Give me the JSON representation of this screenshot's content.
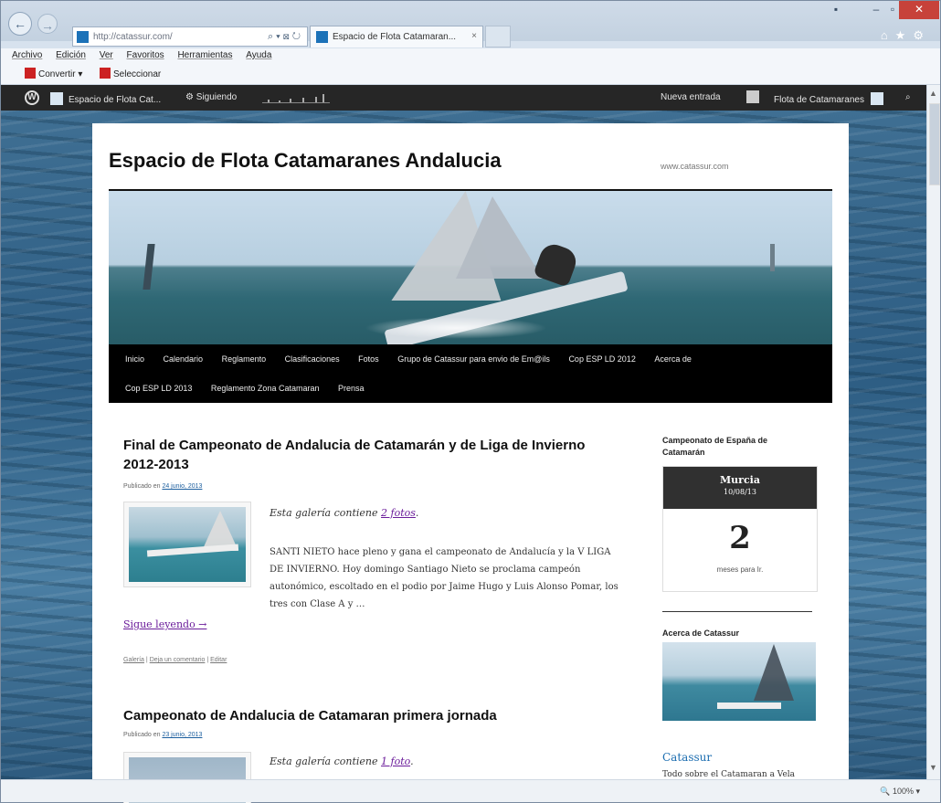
{
  "browser": {
    "url": "http://catassur.com/",
    "tab_title": "Espacio de Flota Catamaran...",
    "menu": [
      "Archivo",
      "Edición",
      "Ver",
      "Favoritos",
      "Herramientas",
      "Ayuda"
    ],
    "cmd_convert": "Convertir",
    "cmd_select": "Seleccionar",
    "zoom": "100%"
  },
  "adminbar": {
    "site_name": "Espacio de Flota Cat...",
    "following": "Siguiendo",
    "new_entry": "Nueva entrada",
    "user_site": "Flota de Catamaranes"
  },
  "site": {
    "title": "Espacio de Flota Catamaranes Andalucia",
    "description": "www.catassur.com"
  },
  "nav": {
    "row1": [
      "Inicio",
      "Calendario",
      "Reglamento",
      "Clasificaciones",
      "Fotos",
      "Grupo de Catassur para envio de Em@ils",
      "Cop ESP LD 2012",
      "Acerca de"
    ],
    "row2": [
      "Cop ESP LD 2013",
      "Reglamento Zona Catamaran",
      "Prensa"
    ]
  },
  "posts": [
    {
      "title": "Final de Campeonato de Andalucia de Catamarán y de Liga de Invierno 2012-2013",
      "posted_label": "Publicado en",
      "date": "24 junio, 2013",
      "gallery_text": "Esta galería contiene",
      "gallery_link": "2 fotos",
      "excerpt": "SANTI NIETO hace pleno y gana el campeonato de Andalucía y la V LIGA DE INVIERNO. Hoy domingo  Santiago Nieto se proclama campeón autonómico, escoltado en el podio por Jaime Hugo y Luis Alonso Pomar, los tres con Clase A y …",
      "more": "Sigue leyendo →",
      "meta_gallery": "Galería",
      "meta_comment": "Deja un comentario",
      "meta_edit": "Editar"
    },
    {
      "title": "Campeonato de Andalucia de Catamaran primera jornada",
      "posted_label": "Publicado en",
      "date": "23 junio, 2013",
      "gallery_text": "Esta galería contiene",
      "gallery_link": "1 foto"
    }
  ],
  "sidebar": {
    "widget1_title": "Campeonato de España de Catamarán",
    "countdown_place": "Murcia",
    "countdown_date": "10/08/13",
    "countdown_value": "2",
    "countdown_label": "meses para Ir.",
    "widget2_title": "Acerca de Catassur",
    "about_link": "Catassur",
    "about_desc": "Todo sobre el Catamaran a Vela"
  }
}
